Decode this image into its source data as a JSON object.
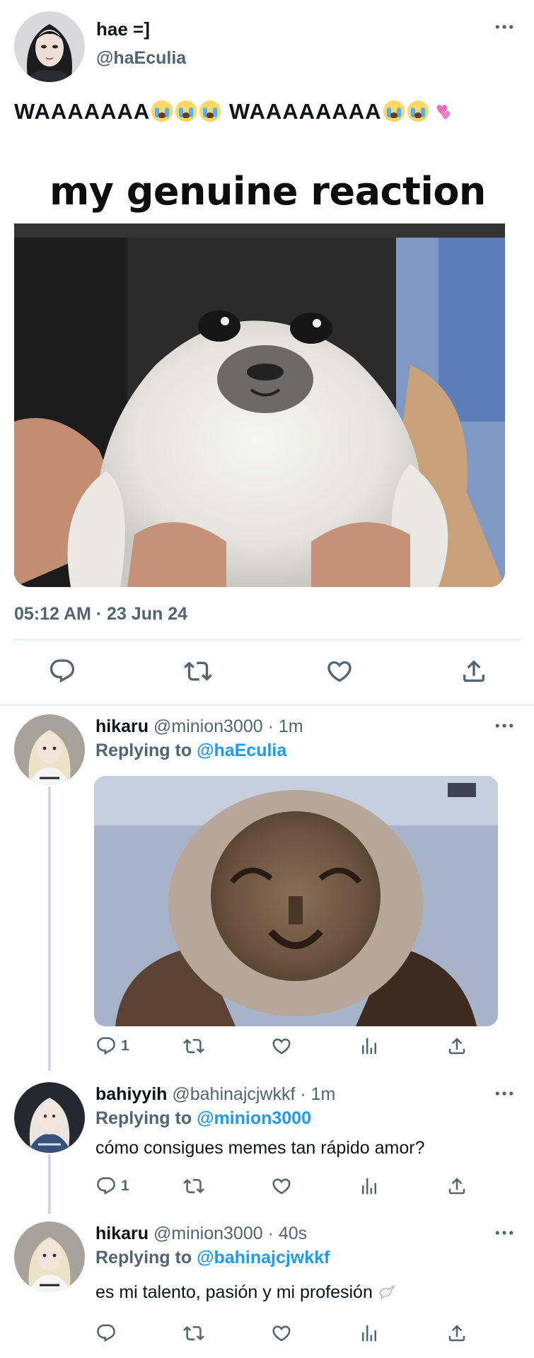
{
  "main_tweet": {
    "name": "hae =]",
    "handle": "@haEculia",
    "text_part1": "WAAAAAAA",
    "text_part2": "WAAAAAAAA",
    "meme_caption": "my genuine reaction",
    "timestamp": "05:12 AM · 23 Jun 24"
  },
  "replies": [
    {
      "name": "hikaru",
      "meta": "@minion3000 · 1m",
      "replying_prefix": "Replying to",
      "mention": "@haEculia",
      "text": "",
      "reply_count": "1"
    },
    {
      "name": "bahiyyih",
      "meta": "@bahinajcjwkkf · 1m",
      "replying_prefix": "Replying to",
      "mention": "@minion3000",
      "text": "cómo consigues memes tan rápido amor?",
      "reply_count": "1"
    },
    {
      "name": "hikaru",
      "meta": "@minion3000 · 40s",
      "replying_prefix": "Replying to",
      "mention": "@bahinajcjwkkf",
      "text": "es mi talento, pasión y mi profesión",
      "reply_count": ""
    }
  ],
  "icons": [
    "more-icon",
    "reply-icon",
    "retweet-icon",
    "like-icon",
    "analytics-icon",
    "share-icon",
    "crying-emoji-icon",
    "heart-emoji-icon",
    "dove-emoji-icon"
  ],
  "colors": {
    "text": "#0f1419",
    "secondary": "#536471",
    "accent": "#1d9bf0",
    "divider": "#cfd9de"
  }
}
